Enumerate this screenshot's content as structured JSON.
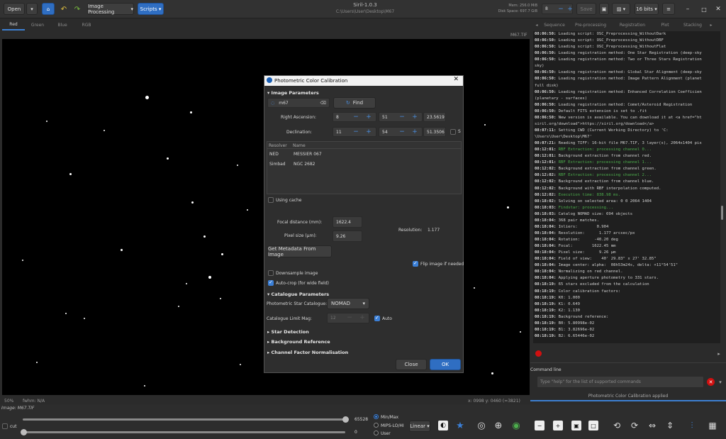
{
  "header": {
    "open_label": "Open",
    "image_processing_label": "Image Processing",
    "scripts_label": "Scripts",
    "app_title": "Siril-1.0.3",
    "file_path": "C:\\Users\\User\\Desktop\\M67",
    "mem": "Mem: 256.0 MiB",
    "disk_space": "Disk Space: 697.7 GiB",
    "threads_value": "8",
    "save_label": "Save",
    "bits_label": "16 bits"
  },
  "view_tabs": [
    "Red",
    "Green",
    "Blue",
    "RGB"
  ],
  "image_name_right": "M67.TIF",
  "right_tabs": [
    "Sequence",
    "Pre-processing",
    "Registration",
    "Plot",
    "Stacking"
  ],
  "log_lines": [
    {
      "t": "08:06:50:",
      "m": " Loading script: OSC_Preprocessing_WithoutDark",
      "c": ""
    },
    {
      "t": "08:06:50:",
      "m": " Loading script: OSC_Preprocessing_WithoutDBF",
      "c": ""
    },
    {
      "t": "08:06:50:",
      "m": " Loading script: OSC_Preprocessing_WithoutFlat",
      "c": ""
    },
    {
      "t": "08:06:50:",
      "m": " Loading registration method: One Star Registration (deep-sky",
      "c": ""
    },
    {
      "t": "08:06:50:",
      "m": " Loading registration method: Two or Three Stars Registration",
      "c": ""
    },
    {
      "t": "",
      "m": "sky)",
      "c": ""
    },
    {
      "t": "08:06:50:",
      "m": " Loading registration method: Global Star Alignment (deep-sky",
      "c": ""
    },
    {
      "t": "08:06:50:",
      "m": " Loading registration method: Image Pattern Alignment (planet",
      "c": ""
    },
    {
      "t": "",
      "m": "full disk)",
      "c": ""
    },
    {
      "t": "08:06:50:",
      "m": " Loading registration method: Enhanced Correlation Coefficien",
      "c": ""
    },
    {
      "t": "",
      "m": "(planetary - surfaces)",
      "c": ""
    },
    {
      "t": "08:06:50:",
      "m": " Loading registration method: Comet/Asteroid Registration",
      "c": ""
    },
    {
      "t": "08:06:50:",
      "m": " Default FITS extension is set to .fit",
      "c": ""
    },
    {
      "t": "08:06:50:",
      "m": " New version is available. You can download it at <a href=\"ht",
      "c": ""
    },
    {
      "t": "",
      "m": "siril.org/download\">https://siril.org/download</a>",
      "c": ""
    },
    {
      "t": "08:07:11:",
      "m": " Setting CWD (Current Working Directory) to 'C:",
      "c": ""
    },
    {
      "t": "",
      "m": "\\Users\\User\\Desktop\\M67'",
      "c": ""
    },
    {
      "t": "08:07:21:",
      "m": " Reading TIFF: 16-bit file M67.TIF, 3 layer(s), 2064x1404 pix",
      "c": ""
    },
    {
      "t": "08:12:01:",
      "m": " RBF Extraction: processing channel 0...",
      "c": "g"
    },
    {
      "t": "08:12:01:",
      "m": " Background extraction from channel red.",
      "c": ""
    },
    {
      "t": "08:12:01:",
      "m": " RBF Extraction: processing channel 1...",
      "c": "g"
    },
    {
      "t": "08:12:02:",
      "m": " Background extraction from channel green.",
      "c": ""
    },
    {
      "t": "08:12:02:",
      "m": " RBF Extraction: processing channel 2...",
      "c": "g"
    },
    {
      "t": "08:12:02:",
      "m": " Background extraction from channel blue.",
      "c": ""
    },
    {
      "t": "08:12:02:",
      "m": " Background with RBF interpolation computed.",
      "c": ""
    },
    {
      "t": "08:12:02:",
      "m": " Execution time: 838.98 ms.",
      "c": "g"
    },
    {
      "t": "08:18:02:",
      "m": " Solving on selected area: 0 0 2064 1404",
      "c": ""
    },
    {
      "t": "08:18:03:",
      "m": " Findstar: processing...",
      "c": "g"
    },
    {
      "t": "08:18:03:",
      "m": " Catalog NOMAD size: 694 objects",
      "c": ""
    },
    {
      "t": "08:18:04:",
      "m": " 368 pair matches.",
      "c": ""
    },
    {
      "t": "08:18:04:",
      "m": " Inliers:        0.904",
      "c": ""
    },
    {
      "t": "08:18:04:",
      "m": " Resolution:      1.177 arcsec/px",
      "c": ""
    },
    {
      "t": "08:18:04:",
      "m": " Rotation:      -40.20 deg",
      "c": ""
    },
    {
      "t": "08:18:04:",
      "m": " Focal:        1622.45 mm",
      "c": ""
    },
    {
      "t": "08:18:04:",
      "m": " Pixel size:      9.26 µm",
      "c": ""
    },
    {
      "t": "08:18:04:",
      "m": " Field of view:    40' 29.83\" x 27' 32.85\"",
      "c": ""
    },
    {
      "t": "08:18:04:",
      "m": " Image center: alpha:  08h53m24s, delta: +11°54'51\"",
      "c": ""
    },
    {
      "t": "08:18:04:",
      "m": " Normalizing on red channel.",
      "c": ""
    },
    {
      "t": "08:18:04:",
      "m": " Applying aperture photometry to 331 stars.",
      "c": ""
    },
    {
      "t": "08:18:19:",
      "m": " 65 stars excluded from the calculation",
      "c": ""
    },
    {
      "t": "08:18:19:",
      "m": " Color calibration factors:",
      "c": ""
    },
    {
      "t": "08:18:19:",
      "m": " K0: 1.000",
      "c": ""
    },
    {
      "t": "08:18:19:",
      "m": " K1: 0.649",
      "c": ""
    },
    {
      "t": "08:18:19:",
      "m": " K2: 1.130",
      "c": ""
    },
    {
      "t": "08:18:19:",
      "m": " Background reference:",
      "c": ""
    },
    {
      "t": "08:18:19:",
      "m": " B0: 5.80998e-02",
      "c": ""
    },
    {
      "t": "08:18:19:",
      "m": " B1: 3.82696e-02",
      "c": ""
    },
    {
      "t": "08:18:19:",
      "m": " B2: 6.65446e-02",
      "c": ""
    }
  ],
  "command_line": {
    "label": "Command line",
    "placeholder": "Type \"help\" for the list of supported commands"
  },
  "status_message": "Photometric Color Calibration applied",
  "dialog": {
    "title": "Photometric Color Calibration",
    "image_parameters": "Image Parameters",
    "object_value": "m67",
    "find_label": "Find",
    "ra_label": "Right Ascension:",
    "ra_h": "8",
    "ra_m": "51",
    "ra_s": "23.5619",
    "dec_label": "Declination:",
    "dec_d": "11",
    "dec_m": "54",
    "dec_s": "51.3506",
    "south_label": "S",
    "resolver_headers": [
      "Resolver",
      "Name"
    ],
    "resolver_rows": [
      {
        "resolver": "NED",
        "name": "MESSIER 067"
      },
      {
        "resolver": "Simbad",
        "name": "NGC 2682"
      }
    ],
    "using_cache": "Using cache",
    "focal_label": "Focal distance (mm):",
    "focal_value": "1622.4",
    "pixel_label": "Pixel size (µm):",
    "pixel_value": "9.26",
    "resolution_label": "Resolution:",
    "resolution_value": "1.177",
    "metadata_button": "Get Metadata From Image",
    "flip_label": "Flip image if needed",
    "downsample_label": "Downsample image",
    "autocrop_label": "Auto-crop (for wide field)",
    "catalogue_parameters": "Catalogue Parameters",
    "star_catalogue_label": "Photometric Star Catalogue:",
    "star_catalogue_value": "NOMAD",
    "limit_mag_label": "Catalogue Limit Mag:",
    "limit_mag_value": "12",
    "auto_label": "Auto",
    "star_detection": "Star Detection",
    "background_reference": "Background Reference",
    "channel_factor": "Channel Factor Normalisation",
    "close_label": "Close",
    "ok_label": "OK"
  },
  "status_bar": {
    "zoom": "50%",
    "fwhm": "fwhm: N/A",
    "coords": "x: 0998 y: 0460 (=3821)"
  },
  "bottom": {
    "image_label": "Image: M67.TIF",
    "cut_label": "cut",
    "high_value": "65528",
    "low_value": "0",
    "radio_minmax": "Min/Max",
    "radio_mips": "MIPS-LO/HI",
    "radio_user": "User",
    "display_mode": "Linear"
  },
  "colors": {
    "accent": "#3d7fd1",
    "log_green": "#4cae4c",
    "stop_red": "#d01010"
  }
}
